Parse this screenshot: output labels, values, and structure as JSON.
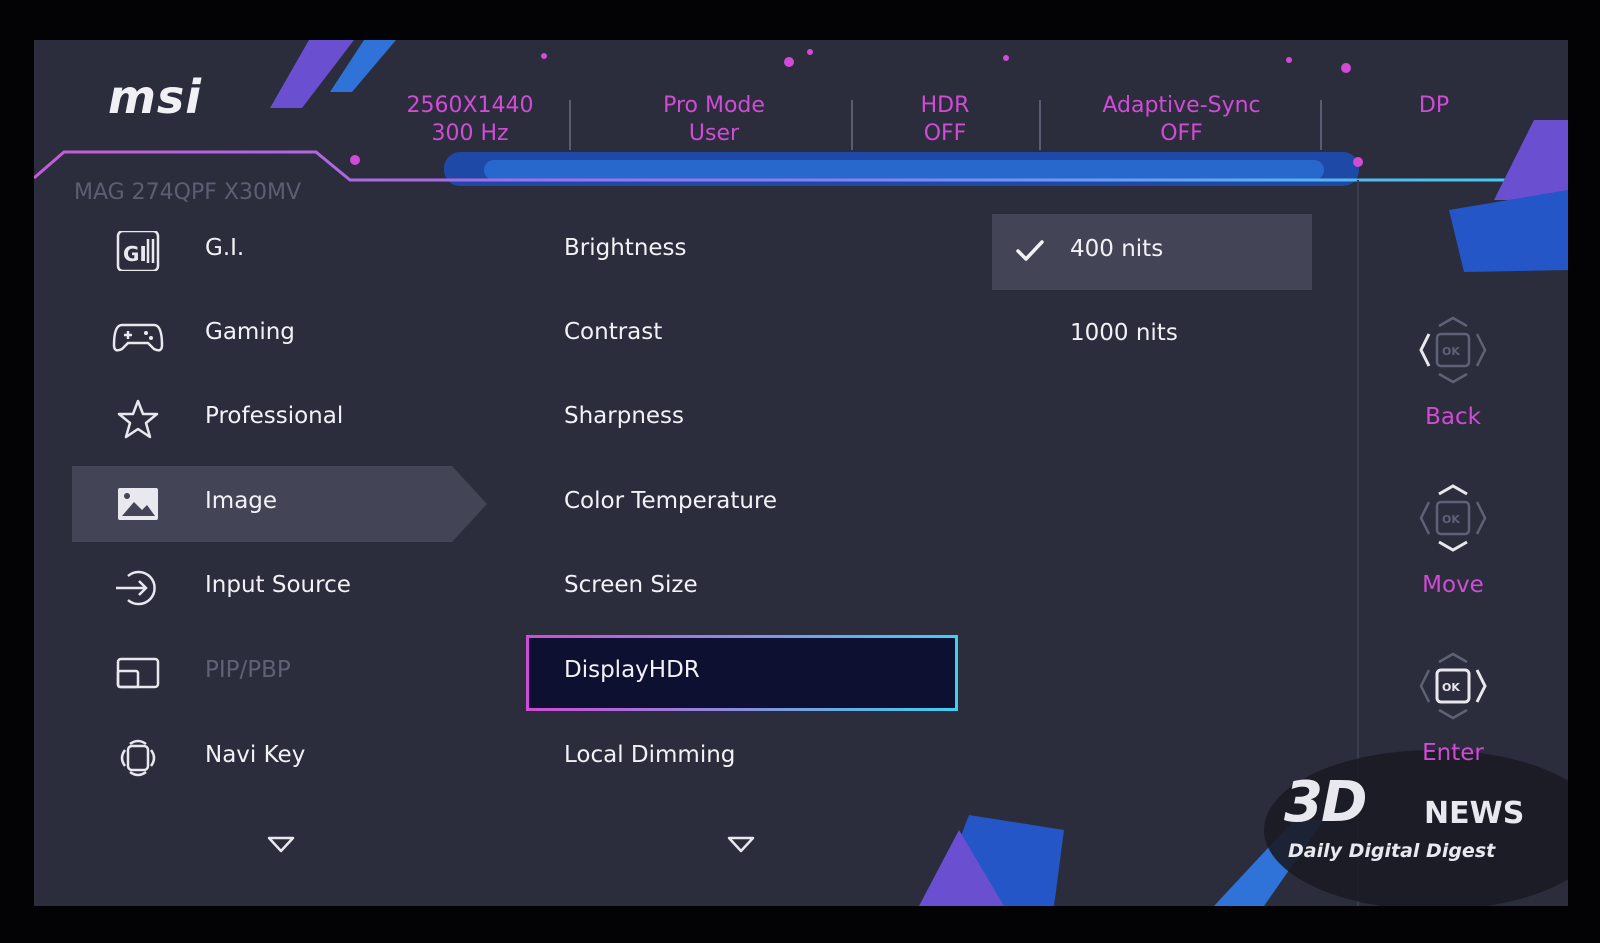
{
  "brand": {
    "logo": "msi",
    "model": "MAG 274QPF X30MV"
  },
  "status_bar": [
    {
      "line1": "2560X1440",
      "line2": "300 Hz"
    },
    {
      "line1": "Pro Mode",
      "line2": "User"
    },
    {
      "line1": "HDR",
      "line2": "OFF"
    },
    {
      "line1": "Adaptive-Sync",
      "line2": "OFF"
    },
    {
      "line1": "DP",
      "line2": ""
    }
  ],
  "main_menu": {
    "items": [
      {
        "label": "G.I.",
        "icon": "gi-icon",
        "state": "normal"
      },
      {
        "label": "Gaming",
        "icon": "gamepad-icon",
        "state": "normal"
      },
      {
        "label": "Professional",
        "icon": "star-icon",
        "state": "normal"
      },
      {
        "label": "Image",
        "icon": "image-icon",
        "state": "active"
      },
      {
        "label": "Input Source",
        "icon": "input-source-icon",
        "state": "normal"
      },
      {
        "label": "PIP/PBP",
        "icon": "pip-icon",
        "state": "disabled"
      },
      {
        "label": "Navi Key",
        "icon": "navi-key-icon",
        "state": "normal"
      }
    ],
    "more_icon": "chevron-down-icon"
  },
  "sub_menu": {
    "items": [
      {
        "label": "Brightness",
        "state": "normal"
      },
      {
        "label": "Contrast",
        "state": "normal"
      },
      {
        "label": "Sharpness",
        "state": "normal"
      },
      {
        "label": "Color Temperature",
        "state": "normal"
      },
      {
        "label": "Screen Size",
        "state": "normal"
      },
      {
        "label": "DisplayHDR",
        "state": "focused"
      },
      {
        "label": "Local Dimming",
        "state": "normal"
      }
    ],
    "more_icon": "chevron-down-icon"
  },
  "options": {
    "items": [
      {
        "label": "400 nits",
        "selected": true
      },
      {
        "label": "1000 nits",
        "selected": false
      }
    ]
  },
  "key_guide": [
    {
      "label": "Back",
      "icon": "joystick-back-icon"
    },
    {
      "label": "Move",
      "icon": "joystick-move-icon"
    },
    {
      "label": "Enter",
      "icon": "joystick-enter-icon"
    }
  ],
  "watermark": {
    "big": "3D",
    "news": "NEWS",
    "tagline": "Daily Digital Digest"
  },
  "colors": {
    "accent_magenta": "#d14bd6",
    "accent_cyan": "#3fd0f0",
    "background": "#2b2d3d",
    "highlight": "#434556"
  }
}
